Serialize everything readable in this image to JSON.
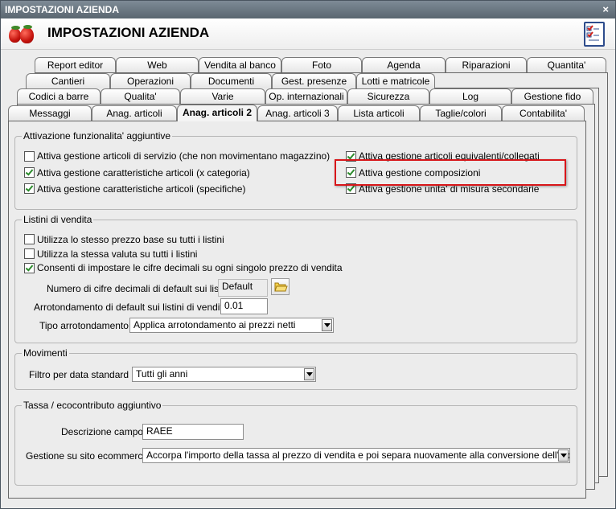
{
  "window": {
    "title": "IMPOSTAZIONI AZIENDA",
    "close": "×"
  },
  "header": {
    "title": "IMPOSTAZIONI AZIENDA",
    "logo_icon": "strawberry-icon",
    "right_icon": "checklist-icon"
  },
  "tabs": {
    "row1": [
      "Report editor",
      "Web",
      "Vendita al banco",
      "Foto",
      "Agenda",
      "Riparazioni",
      "Quantita'"
    ],
    "row2": [
      "Cantieri",
      "Operazioni",
      "Documenti",
      "Gest. presenze",
      "Lotti e matricole"
    ],
    "row3": [
      "Codici a barre",
      "Qualita'",
      "Varie",
      "Op. internazionali",
      "Sicurezza",
      "Log",
      "Gestione fido"
    ],
    "row4": [
      "Messaggi",
      "Anag. articoli",
      "Anag. articoli 2",
      "Anag. articoli 3",
      "Lista articoli",
      "Taglie/colori",
      "Contabilita'"
    ],
    "selected": "Anag. articoli 2"
  },
  "attivazione": {
    "title": "Attivazione funzionalita' aggiuntive",
    "items": [
      {
        "label": "Attiva gestione articoli di servizio (che non movimentano magazzino)",
        "checked": false
      },
      {
        "label": "Attiva gestione caratteristiche articoli (x categoria)",
        "checked": true
      },
      {
        "label": "Attiva gestione caratteristiche articoli (specifiche)",
        "checked": true
      },
      {
        "label": "Attiva gestione articoli equivalenti/collegati",
        "checked": true
      },
      {
        "label": "Attiva gestione composizioni",
        "checked": true
      },
      {
        "label": "Attiva gestione unita' di misura secondarie",
        "checked": true
      }
    ]
  },
  "listini": {
    "title": "Listini di vendita",
    "items": [
      {
        "label": "Utilizza lo stesso prezzo base su tutti i listini",
        "checked": false
      },
      {
        "label": "Utilizza la stessa valuta su tutti i listini",
        "checked": false
      },
      {
        "label": "Consenti di impostare le cifre decimali su ogni singolo prezzo di vendita",
        "checked": true
      }
    ],
    "decimali_label": "Numero di cifre decimali di default sui listini :",
    "decimali_value": "Default",
    "arrotondamento_label": "Arrotondamento di default sui listini di vendita :",
    "arrotondamento_value": "0.01",
    "tipo_label": "Tipo arrotondamento :",
    "tipo_value": "Applica arrotondamento ai prezzi netti"
  },
  "movimenti": {
    "title": "Movimenti",
    "filtro_label": "Filtro per data standard :",
    "filtro_value": "Tutti gli anni"
  },
  "tassa": {
    "title": "Tassa / ecocontributo aggiuntivo",
    "descrizione_label": "Descrizione campo :",
    "descrizione_value": "RAEE",
    "gestione_label": "Gestione su sito ecommerce :",
    "gestione_value": "Accorpa l'importo della tassa al prezzo di vendita e poi separa nuovamente alla conversione dell'ordine web"
  }
}
